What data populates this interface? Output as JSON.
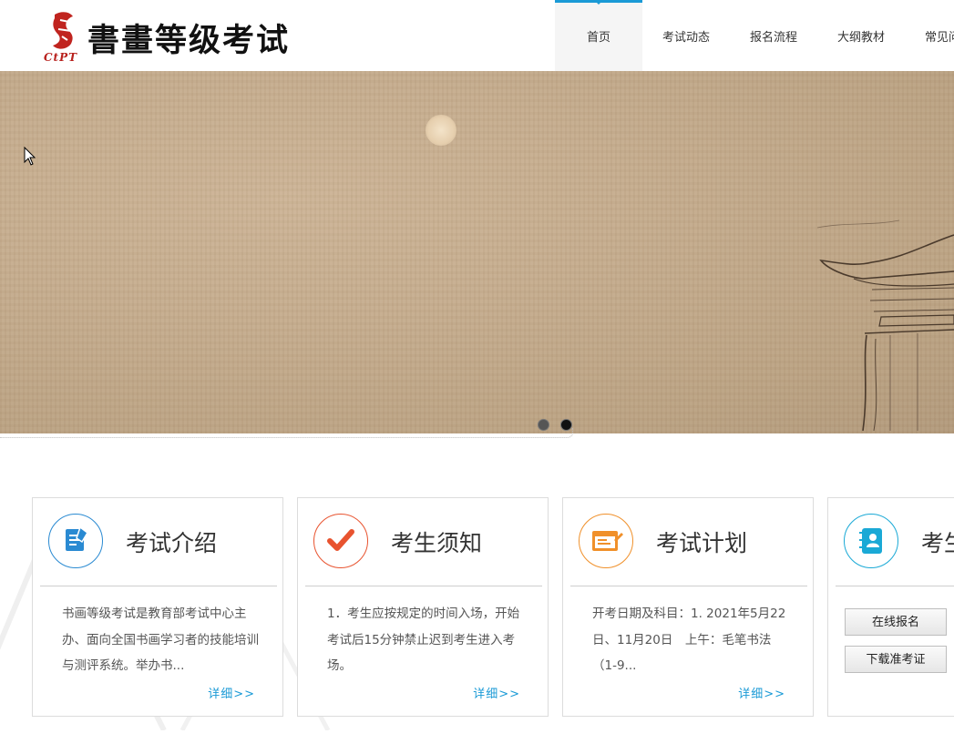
{
  "brand": {
    "title": "書畫等级考试",
    "subtitle": "CtPT"
  },
  "nav": [
    {
      "label": "首页",
      "active": true
    },
    {
      "label": "考试动态"
    },
    {
      "label": "报名流程"
    },
    {
      "label": "大纲教材"
    },
    {
      "label": "常见问题"
    }
  ],
  "slider": {
    "count": 2,
    "active": 1
  },
  "cards": [
    {
      "title": "考试介绍",
      "icon": "document-edit-icon",
      "color": "#2a8ad2",
      "text": "书画等级考试是教育部考试中心主办、面向全国书画学习者的技能培训与测评系统。举办书...",
      "more": "详细>>"
    },
    {
      "title": "考生须知",
      "icon": "checkmark-icon",
      "color": "#e8532f",
      "text": "1．考生应按规定的时间入场，开始考试后15分钟禁止迟到考生进入考场。",
      "more": "详细>>"
    },
    {
      "title": "考试计划",
      "icon": "calendar-edit-icon",
      "color": "#f0902a",
      "text": "开考日期及科目：1. 2021年5月22日、11月20日　上午：毛笔书法（1-9...",
      "more": "详细>>"
    },
    {
      "title": "考生服务",
      "icon": "address-book-icon",
      "color": "#1aa9d6",
      "buttons": [
        "在线报名",
        "下载准考证"
      ]
    }
  ]
}
